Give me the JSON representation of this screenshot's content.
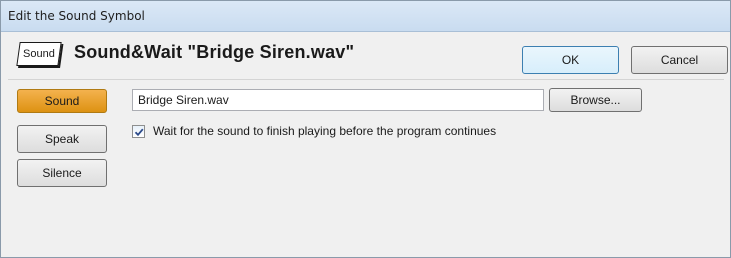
{
  "window": {
    "title": "Edit the Sound Symbol"
  },
  "header": {
    "symbol_badge": "Sound",
    "text": "Sound&Wait \"Bridge Siren.wav\""
  },
  "buttons": {
    "ok": "OK",
    "cancel": "Cancel",
    "browse": "Browse..."
  },
  "modes": {
    "selected": "Sound",
    "items": [
      "Sound",
      "Speak",
      "Silence"
    ]
  },
  "file": {
    "value": "Bridge Siren.wav"
  },
  "wait_option": {
    "checked": true,
    "label": "Wait for the sound to finish playing before the program continues"
  },
  "colors": {
    "selected_mode": "#e8a02a",
    "title_bar": "#d4e3f3",
    "ok_border": "#3c7fb1"
  },
  "icons": {
    "checkbox": "checkmark-icon"
  }
}
